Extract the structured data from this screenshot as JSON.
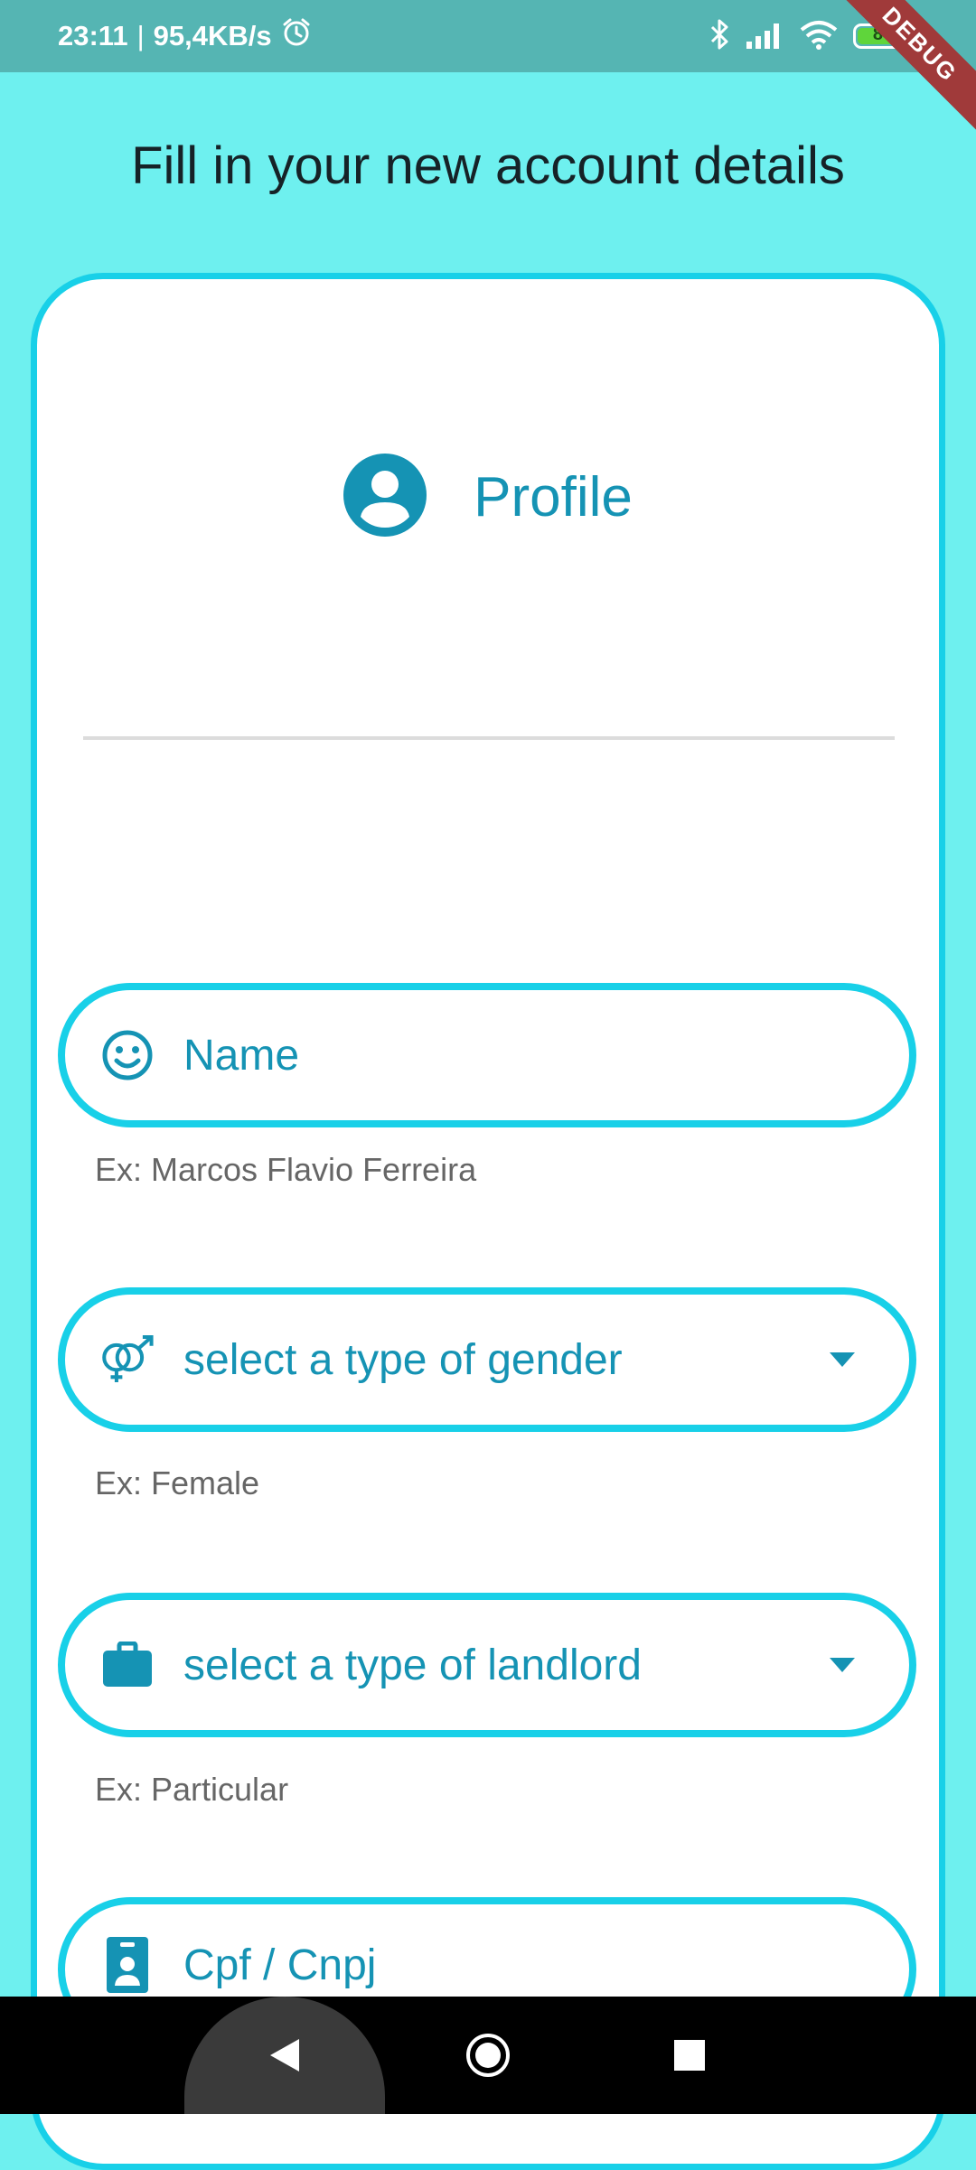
{
  "status_bar": {
    "time": "23:11",
    "separator": "|",
    "net_speed": "95,4KB/s",
    "battery_level": "84",
    "debug_label": "DEBUG",
    "icons": [
      "alarm-icon",
      "bluetooth-icon",
      "signal-icon",
      "wifi-icon",
      "battery-icon"
    ]
  },
  "header": {
    "title": "Fill in your new account details"
  },
  "profile": {
    "label": "Profile",
    "icon": "account-circle-icon"
  },
  "form": {
    "name": {
      "label": "Name",
      "helper": "Ex: Marcos Flavio Ferreira",
      "icon": "smiley-icon"
    },
    "gender": {
      "placeholder": "select a type of gender",
      "helper": "Ex: Female",
      "icon": "gender-icon"
    },
    "landlord": {
      "placeholder": "select a type of landlord",
      "helper": "Ex: Particular",
      "icon": "briefcase-icon"
    },
    "document": {
      "label": "Cpf / Cnpj",
      "icon": "badge-icon"
    }
  },
  "colors": {
    "background": "#6ef0ef",
    "status_bar": "#55b5b3",
    "accent_border": "#18d0e8",
    "accent_text": "#1593b4"
  }
}
